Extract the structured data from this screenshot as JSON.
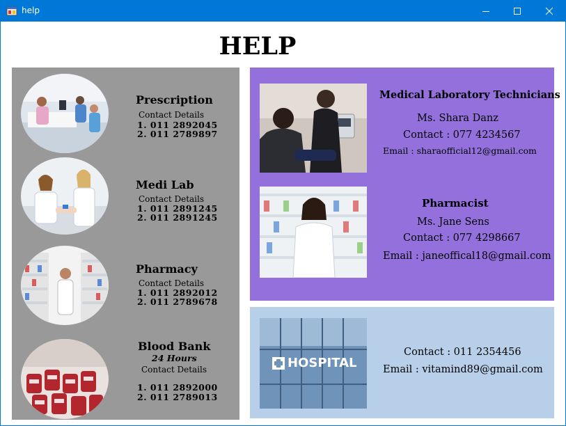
{
  "window": {
    "title": "help"
  },
  "page": {
    "heading": "HELP"
  },
  "services": [
    {
      "name": "Prescription",
      "contact_label": "Contact Details",
      "phones": [
        "1.  011 2892045",
        " 2.  011 2789897"
      ]
    },
    {
      "name": "Medi Lab",
      "contact_label": "Contact Details",
      "phones": [
        "1.  011 2891245",
        " 2.  011 2891245"
      ]
    },
    {
      "name": "Pharmacy",
      "contact_label": "Contact Details",
      "phones": [
        "1.  011 2892012",
        " 2.  011 2789678"
      ]
    },
    {
      "name": "Blood Bank",
      "hours": "24 Hours",
      "contact_label": "Contact Details",
      "phones": [
        "1.  011 2892000",
        "2.  011 2789013"
      ]
    }
  ],
  "contacts": {
    "lab": {
      "role": "Medical Laboratory Technicians",
      "name": "Ms. Shara Danz",
      "contact": "Contact : 077 4234567",
      "email": "Email : sharaofficial12@gmail.com"
    },
    "pharmacist": {
      "role": "Pharmacist",
      "name": "Ms. Jane Sens",
      "contact": "Contact : 077 4298667",
      "email": "Email : janeoffical18@gmail.com"
    },
    "hospital": {
      "sign": "HOSPITAL",
      "contact": "Contact : 011 2354456",
      "email": "Email : vitamind89@gmail.com"
    }
  },
  "colors": {
    "titlebar": "#0078d7",
    "left_panel": "#999999",
    "purple_panel": "#9370db",
    "blue_panel": "#b8cfe9"
  },
  "icons": [
    "app-icon",
    "minimize-icon",
    "maximize-icon",
    "close-icon"
  ]
}
